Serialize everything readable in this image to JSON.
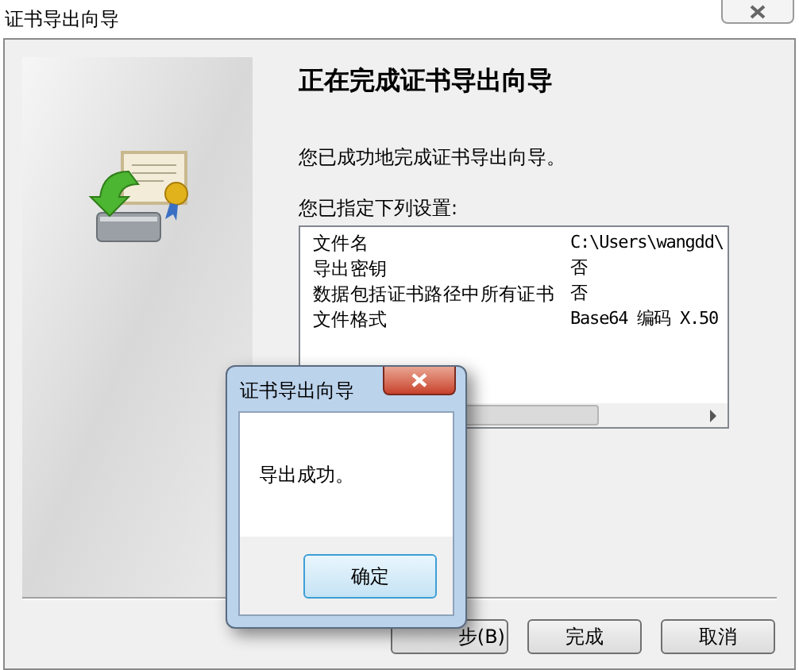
{
  "window": {
    "title": "证书导出向导"
  },
  "heading": "正在完成证书导出向导",
  "message": "您已成功地完成证书导出向导。",
  "settings_label": "您已指定下列设置:",
  "settings": [
    {
      "name": "文件名",
      "value": "C:\\Users\\wangdd\\"
    },
    {
      "name": "导出密钥",
      "value": "否"
    },
    {
      "name": "数据包括证书路径中所有证书",
      "value": "否"
    },
    {
      "name": "文件格式",
      "value": "Base64 编码 X.50"
    }
  ],
  "buttons": [
    {
      "kind": "back",
      "label": "步(B)"
    },
    {
      "kind": "finish",
      "label": "完成"
    },
    {
      "kind": "cancel",
      "label": "取消"
    }
  ],
  "dialog": {
    "title": "证书导出向导",
    "message": "导出成功。",
    "button": "确定"
  }
}
